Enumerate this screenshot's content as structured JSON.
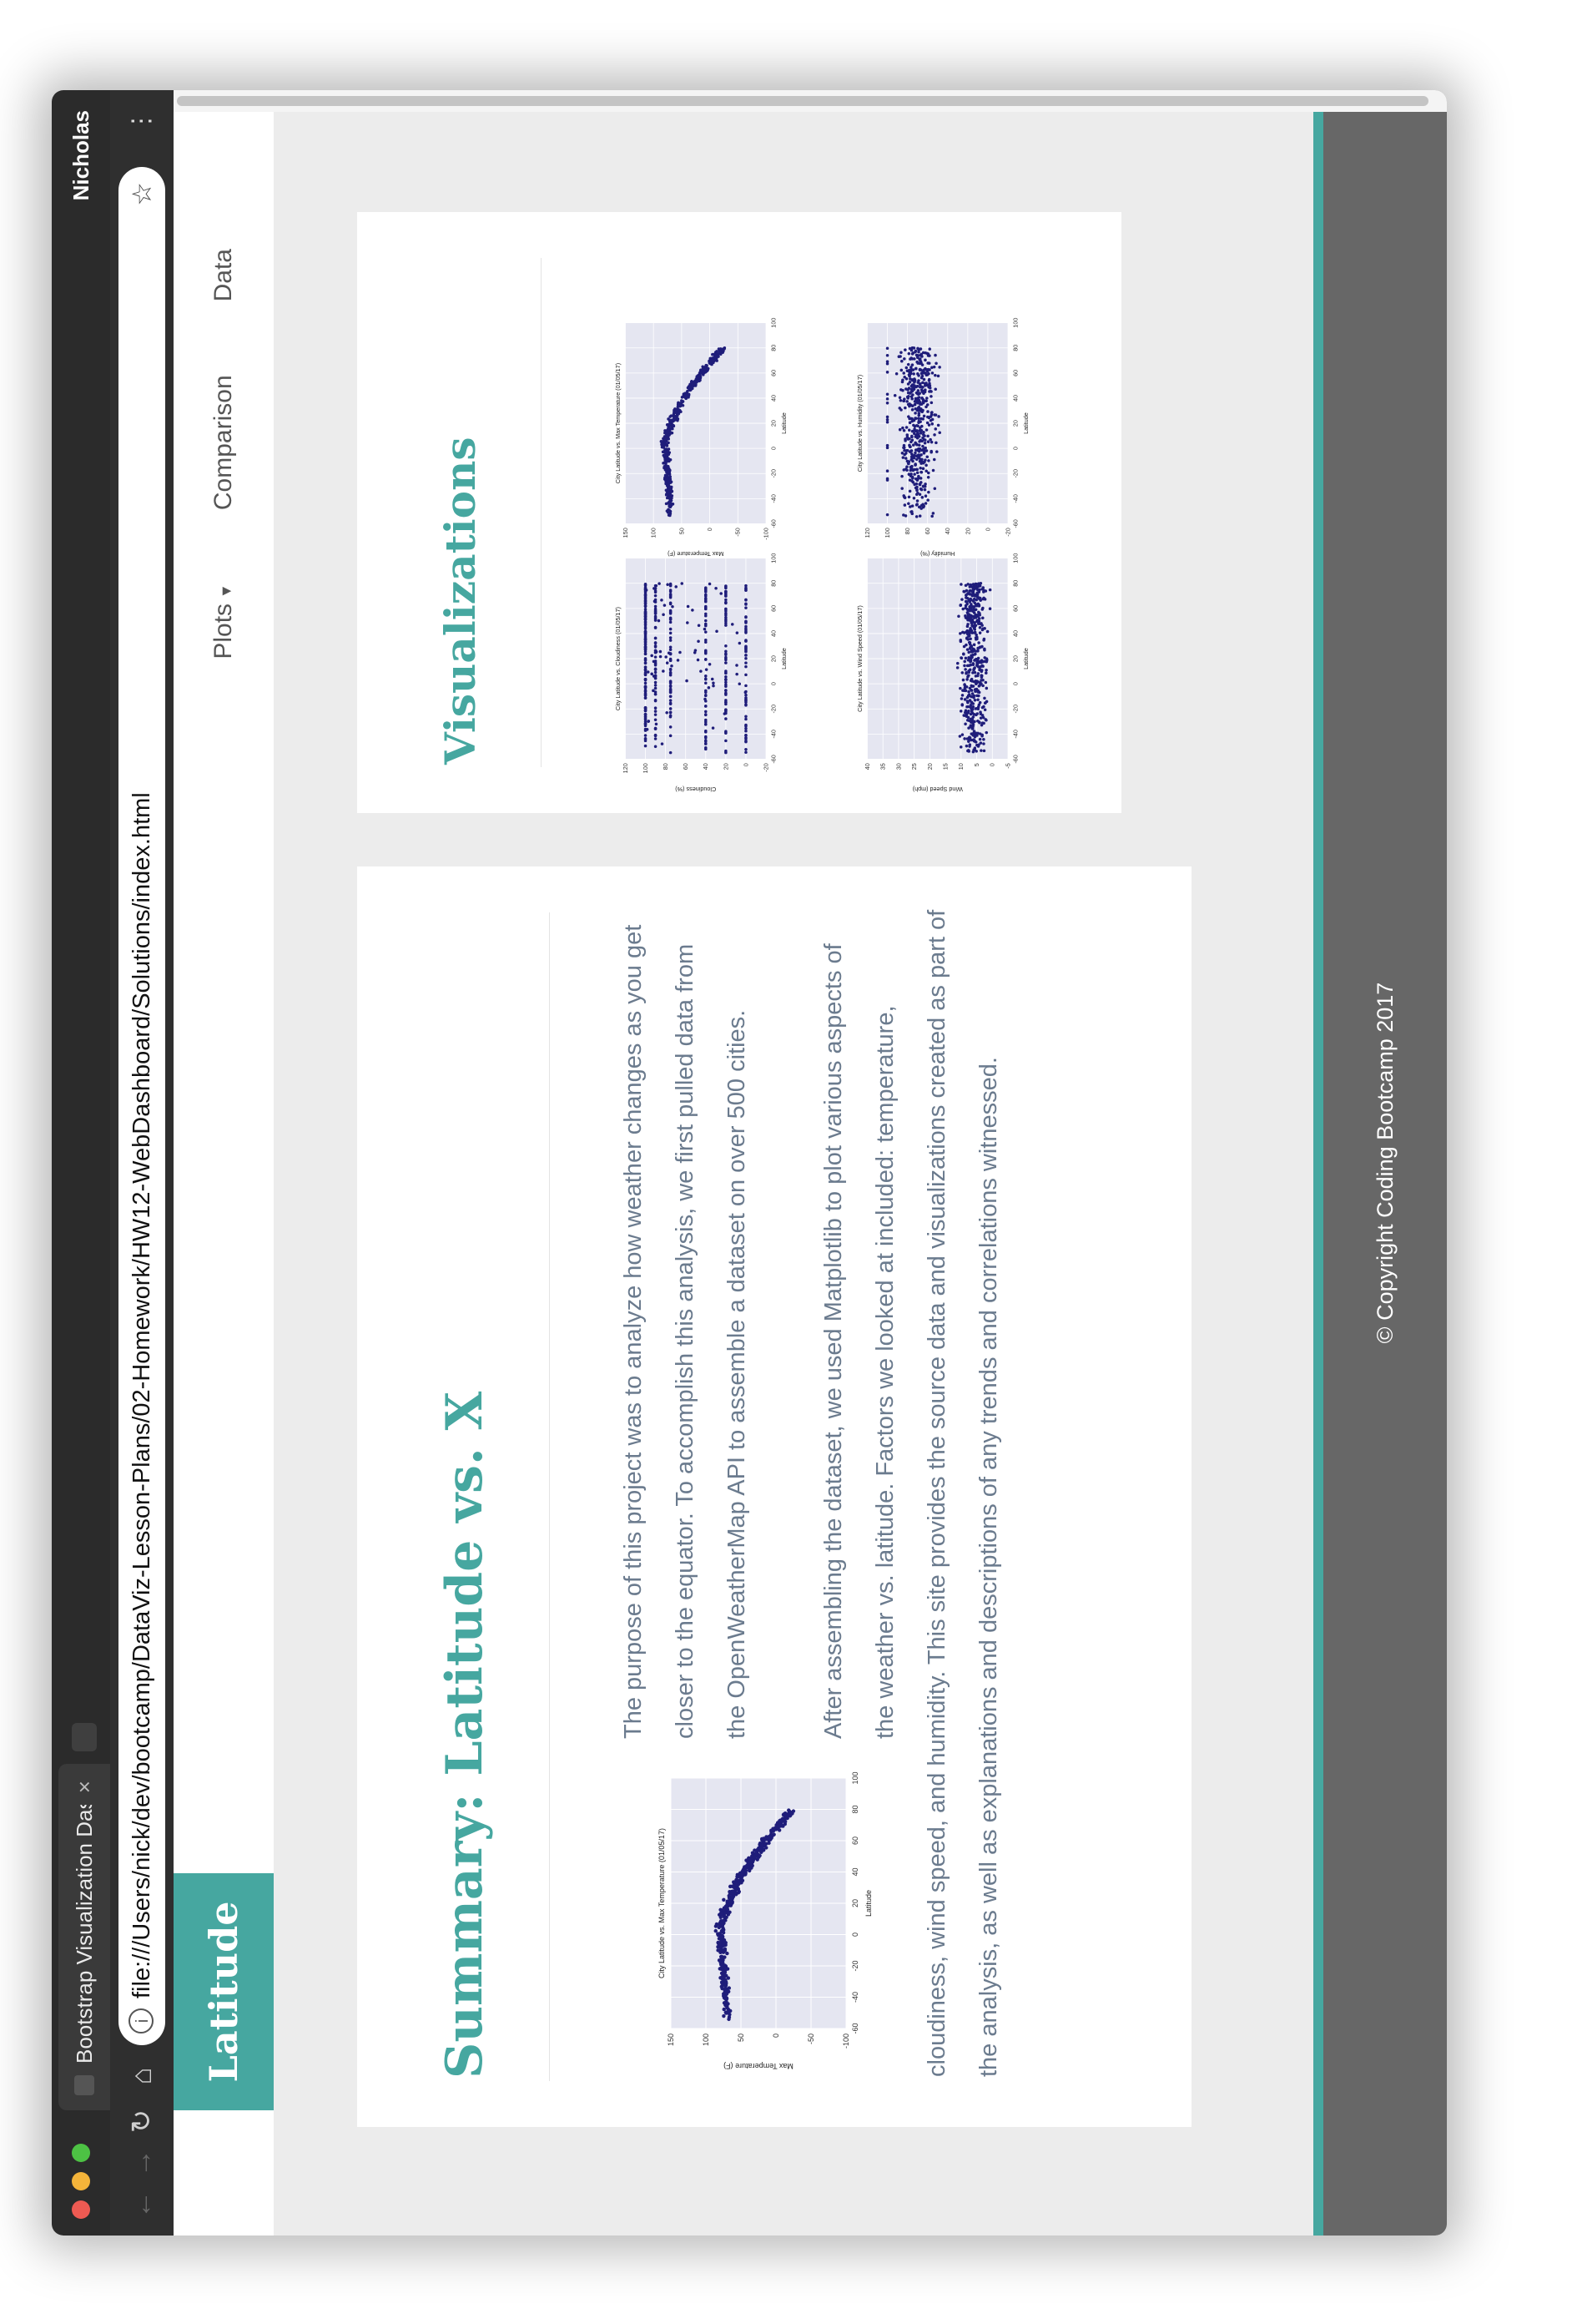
{
  "browser": {
    "tab_title": "Bootstrap Visualization Dashb",
    "tab_close": "×",
    "profile_name": "Nicholas",
    "url": "file:///Users/nick/dev/bootcamp/DataViz-Lesson-Plans/02-Homework/HW12-WebDashboard/Solutions/index.html",
    "icons": {
      "back": "back-arrow-icon",
      "forward": "forward-arrow-icon",
      "reload": "reload-icon",
      "home": "home-icon",
      "info": "info-icon",
      "bookmark": "star-icon",
      "menu": "kebab-menu-icon"
    }
  },
  "navbar": {
    "brand": "Latitude",
    "links": [
      {
        "label": "Plots",
        "dropdown": true
      },
      {
        "label": "Comparison",
        "dropdown": false
      },
      {
        "label": "Data",
        "dropdown": false
      }
    ]
  },
  "summary": {
    "title": "Summary: Latitude vs. X",
    "paragraph_1": "The purpose of this project was to analyze how weather changes as you get closer to the equator. To accomplish this analysis, we first pulled data from the OpenWeatherMap API to assemble a dataset on over 500 cities.",
    "paragraph_2": "After assembling the dataset, we used Matplotlib to plot various aspects of the weather vs. latitude. Factors we looked at included: temperature, cloudiness, wind speed, and humidity. This site provides the source data and visualizations created as part of the analysis, as well as explanations and descriptions of any trends and correlations witnessed."
  },
  "visualizations": {
    "title": "Visualizations"
  },
  "footer": {
    "copyright": "© Copyright Coding Bootcamp 2017"
  },
  "colors": {
    "accent": "#46a7a0",
    "footer_bg": "#676767",
    "page_bg": "#ececec",
    "text": "#6b7b8e",
    "marker": "#1f1d7a",
    "plot_bg": "#e5e6f1"
  },
  "chart_data": [
    {
      "id": "summary-temp",
      "type": "scatter",
      "title": "City Latitude vs. Max Temperature (01/05/17)",
      "xlabel": "Latitude",
      "ylabel": "Max Temperature (F)",
      "xlim": [
        -60,
        100
      ],
      "ylim": [
        -100,
        150
      ],
      "xticks": [
        -60,
        -40,
        -20,
        0,
        20,
        40,
        60,
        80,
        100
      ],
      "yticks": [
        -100,
        -50,
        0,
        50,
        100,
        150
      ],
      "pattern": "temp"
    },
    {
      "id": "vis-temp",
      "type": "scatter",
      "title": "City Latitude vs. Max Temperature (01/05/17)",
      "xlabel": "Latitude",
      "ylabel": "Max Temperature (F)",
      "xlim": [
        -60,
        100
      ],
      "ylim": [
        -100,
        150
      ],
      "xticks": [
        -60,
        -40,
        -20,
        0,
        20,
        40,
        60,
        80,
        100
      ],
      "yticks": [
        -100,
        -50,
        0,
        50,
        100,
        150
      ],
      "pattern": "temp"
    },
    {
      "id": "vis-humidity",
      "type": "scatter",
      "title": "City Latitude vs. Humidity (01/05/17)",
      "xlabel": "Latitude",
      "ylabel": "Humidity (%)",
      "xlim": [
        -60,
        100
      ],
      "ylim": [
        -20,
        120
      ],
      "xticks": [
        -60,
        -40,
        -20,
        0,
        20,
        40,
        60,
        80,
        100
      ],
      "yticks": [
        -20,
        0,
        20,
        40,
        60,
        80,
        100,
        120
      ],
      "pattern": "humidity"
    },
    {
      "id": "vis-cloud",
      "type": "scatter",
      "title": "City Latitude vs. Cloudiness (01/05/17)",
      "xlabel": "Latitude",
      "ylabel": "Cloudiness (%)",
      "xlim": [
        -60,
        100
      ],
      "ylim": [
        -20,
        120
      ],
      "xticks": [
        -60,
        -40,
        -20,
        0,
        20,
        40,
        60,
        80,
        100
      ],
      "yticks": [
        -20,
        0,
        20,
        40,
        60,
        80,
        100,
        120
      ],
      "pattern": "cloud"
    },
    {
      "id": "vis-wind",
      "type": "scatter",
      "title": "City Latitude vs. Wind Speed (01/05/17)",
      "xlabel": "Latitude",
      "ylabel": "Wind Speed (mph)",
      "xlim": [
        -60,
        100
      ],
      "ylim": [
        -5,
        40
      ],
      "xticks": [
        -60,
        -40,
        -20,
        0,
        20,
        40,
        60,
        80,
        100
      ],
      "yticks": [
        -5,
        0,
        5,
        10,
        15,
        20,
        25,
        30,
        35,
        40
      ],
      "pattern": "wind"
    }
  ]
}
